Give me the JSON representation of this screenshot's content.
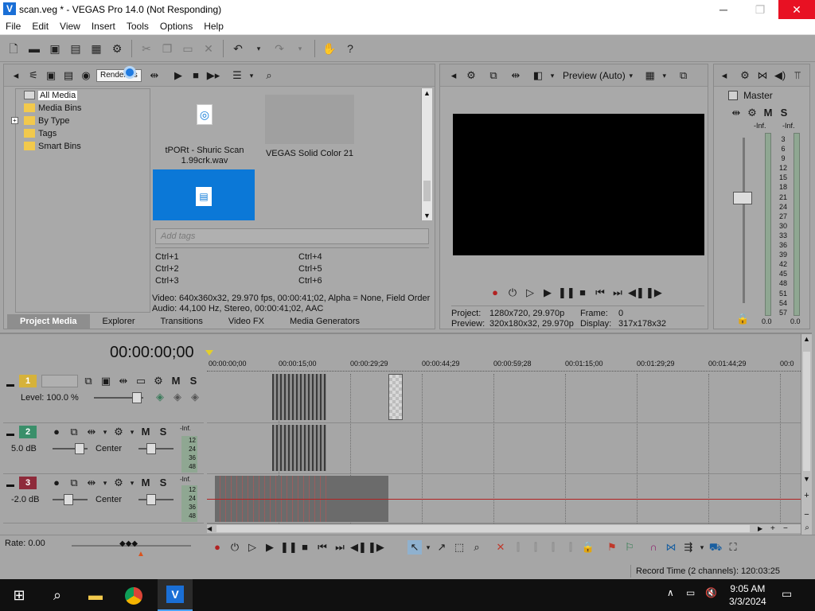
{
  "window": {
    "title": "scan.veg * - VEGAS Pro 14.0 (Not Responding)"
  },
  "menu": [
    "File",
    "Edit",
    "View",
    "Insert",
    "Tools",
    "Options",
    "Help"
  ],
  "tooltip": "Render As",
  "project_media": {
    "tree": [
      "All Media",
      "Media Bins",
      "By Type",
      "Tags",
      "Smart Bins"
    ],
    "expander": "+",
    "items": [
      {
        "label": "tPORt - Shuric Scan 1.99crk.wav"
      },
      {
        "label": "VEGAS Solid Color 21"
      }
    ],
    "tags_placeholder": "Add tags",
    "shortcuts": [
      "Ctrl+1",
      "Ctrl+2",
      "Ctrl+3",
      "Ctrl+4",
      "Ctrl+5",
      "Ctrl+6"
    ],
    "info_video": "Video: 640x360x32, 29.970 fps, 00:00:41;02, Alpha = None, Field Order",
    "info_audio": "Audio: 44,100 Hz, Stereo, 00:00:41;02, AAC",
    "tabs": [
      "Project Media",
      "Explorer",
      "Transitions",
      "Video FX",
      "Media Generators"
    ]
  },
  "preview": {
    "mode": "Preview (Auto)",
    "project_label": "Project:",
    "project_value": "1280x720, 29.970p",
    "preview_label": "Preview:",
    "preview_value": "320x180x32, 29.970p",
    "frame_label": "Frame:",
    "frame_value": "0",
    "display_label": "Display:",
    "display_value": "317x178x32"
  },
  "mixer": {
    "title": "Master",
    "inf_left": "-Inf.",
    "inf_right": "-Inf.",
    "scale": [
      "3",
      "6",
      "9",
      "12",
      "15",
      "18",
      "21",
      "24",
      "27",
      "30",
      "33",
      "36",
      "39",
      "42",
      "45",
      "48",
      "51",
      "54",
      "57"
    ],
    "level_left": "0.0",
    "level_right": "0.0"
  },
  "timeline": {
    "timecode": "00:00:00;00",
    "ruler": [
      "00:00:00;00",
      "00:00:15;00",
      "00:00:29;29",
      "00:00:44;29",
      "00:00:59;28",
      "00:01:15;00",
      "00:01:29;29",
      "00:01:44;29",
      "00:0"
    ],
    "tracks": [
      {
        "number": "1",
        "level": "Level: 100.0 %"
      },
      {
        "number": "2",
        "level": "5.0 dB",
        "pan": "Center",
        "inf": "-Inf.",
        "meter": [
          "12",
          "24",
          "36",
          "48"
        ]
      },
      {
        "number": "3",
        "level": "-2.0 dB",
        "pan": "Center",
        "inf": "-Inf.",
        "meter": [
          "12",
          "24",
          "36",
          "48"
        ]
      }
    ],
    "rate": "Rate: 0.00"
  },
  "status": {
    "record_time": "Record Time (2 channels): 120:03:25"
  },
  "taskbar": {
    "time": "9:05 AM",
    "date": "3/3/2024"
  },
  "colors": {
    "selection": "#0b78d7",
    "track1": "#d6b23a",
    "track2": "#3a8f6a",
    "track3": "#8e2a3a",
    "playhead": "#b22222"
  }
}
